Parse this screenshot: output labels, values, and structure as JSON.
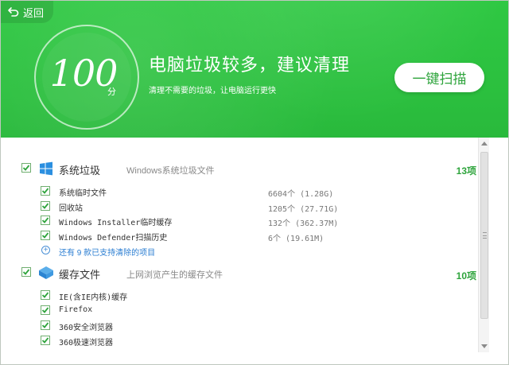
{
  "header": {
    "back_label": "返回",
    "score": "100",
    "score_unit": "分",
    "headline": "电脑垃圾较多，建议清理",
    "subline": "清理不需要的垃圾，让电脑运行更快",
    "clean_button": "一键扫描",
    "colors": {
      "bg": "#2fc843",
      "accent": "#2ea43c"
    }
  },
  "categories": [
    {
      "title": "系统垃圾",
      "desc": "Windows系统垃圾文件",
      "count": "13项",
      "icon": "windows-icon",
      "items": [
        {
          "label": "系统临时文件",
          "size": "6604个 (1.28G)"
        },
        {
          "label": "回收站",
          "size": "1205个 (27.71G)"
        },
        {
          "label": "Windows Installer临时缓存",
          "size": "132个 (362.37M)"
        },
        {
          "label": "Windows Defender扫描历史",
          "size": "6个 (19.61M)"
        }
      ],
      "more_link": "还有 9 款已支持清除的项目"
    },
    {
      "title": "缓存文件",
      "desc": "上网浏览产生的缓存文件",
      "count": "10项",
      "icon": "cache-icon",
      "items": [
        {
          "label": "IE(含IE内核)缓存"
        },
        {
          "label": "Firefox"
        },
        {
          "label": "360安全浏览器"
        },
        {
          "label": "360极速浏览器"
        }
      ]
    }
  ]
}
